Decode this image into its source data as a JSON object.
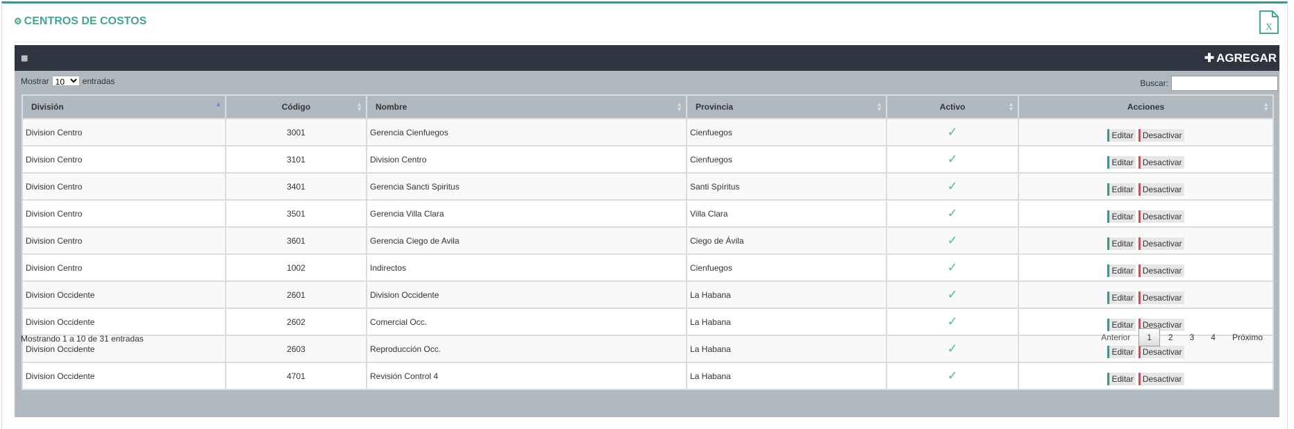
{
  "header": {
    "title": "CENTROS DE COSTOS",
    "title_icon": "gear-icon",
    "export_icon": "excel-file-icon"
  },
  "toolbar": {
    "grid_icon": "table-icon",
    "add_label": "AGREGAR"
  },
  "controls": {
    "show_prefix": "Mostrar",
    "page_size": "10",
    "show_suffix": "entradas",
    "search_label": "Buscar:",
    "search_value": ""
  },
  "columns": [
    "División",
    "Código",
    "Nombre",
    "Provincia",
    "Activo",
    "Acciones"
  ],
  "rows": [
    {
      "division": "Division Centro",
      "codigo": "3001",
      "nombre": "Gerencia Cienfuegos",
      "provincia": "Cienfuegos",
      "activo": true
    },
    {
      "division": "Division Centro",
      "codigo": "3101",
      "nombre": "Division Centro",
      "provincia": "Cienfuegos",
      "activo": true
    },
    {
      "division": "Division Centro",
      "codigo": "3401",
      "nombre": "Gerencia Sancti Spiritus",
      "provincia": "Santi Spíritus",
      "activo": true
    },
    {
      "division": "Division Centro",
      "codigo": "3501",
      "nombre": "Gerencia Villa Clara",
      "provincia": "Villa Clara",
      "activo": true
    },
    {
      "division": "Division Centro",
      "codigo": "3601",
      "nombre": "Gerencia Ciego de Avila",
      "provincia": "Ciego de Ávila",
      "activo": true
    },
    {
      "division": "Division Centro",
      "codigo": "1002",
      "nombre": "Indirectos",
      "provincia": "Cienfuegos",
      "activo": true
    },
    {
      "division": "Division Occidente",
      "codigo": "2601",
      "nombre": "Division Occidente",
      "provincia": "La Habana",
      "activo": true
    },
    {
      "division": "Division Occidente",
      "codigo": "2602",
      "nombre": "Comercial Occ.",
      "provincia": "La Habana",
      "activo": true
    },
    {
      "division": "Division Occidente",
      "codigo": "2603",
      "nombre": "Reproducción Occ.",
      "provincia": "La Habana",
      "activo": true
    },
    {
      "division": "Division Occidente",
      "codigo": "4701",
      "nombre": "Revisión Control 4",
      "provincia": "La Habana",
      "activo": true
    }
  ],
  "actions": {
    "edit": "Editar",
    "deactivate": "Desactivar"
  },
  "footer": {
    "info": "Mostrando 1 a 10 de 31 entradas",
    "prev": "Anterior",
    "pages": [
      "1",
      "2",
      "3",
      "4"
    ],
    "current_page": "1",
    "next": "Próximo"
  },
  "colors": {
    "accent": "#3a9688",
    "dark_bar": "#2e3440",
    "panel": "#b1b9c0",
    "deactivate": "#c9505a"
  }
}
